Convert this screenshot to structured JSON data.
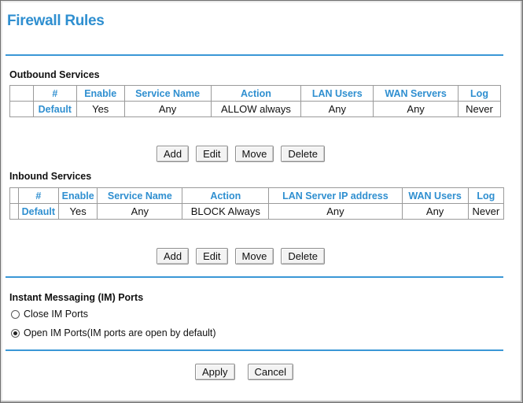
{
  "page": {
    "title": "Firewall Rules"
  },
  "outbound": {
    "heading": "Outbound Services",
    "columns": [
      "#",
      "Enable",
      "Service Name",
      "Action",
      "LAN Users",
      "WAN Servers",
      "Log"
    ],
    "rows": [
      [
        "Default",
        "Yes",
        "Any",
        "ALLOW always",
        "Any",
        "Any",
        "Never"
      ]
    ],
    "buttons": {
      "add": "Add",
      "edit": "Edit",
      "move": "Move",
      "delete": "Delete"
    }
  },
  "inbound": {
    "heading": "Inbound Services",
    "columns": [
      "#",
      "Enable",
      "Service Name",
      "Action",
      "LAN Server IP address",
      "WAN Users",
      "Log"
    ],
    "rows": [
      [
        "Default",
        "Yes",
        "Any",
        "BLOCK Always",
        "Any",
        "Any",
        "Never"
      ]
    ],
    "buttons": {
      "add": "Add",
      "edit": "Edit",
      "move": "Move",
      "delete": "Delete"
    }
  },
  "im": {
    "heading": "Instant Messaging (IM) Ports",
    "options": [
      {
        "label": "Close IM Ports",
        "selected": false
      },
      {
        "label": "Open IM Ports(IM ports are open by default)",
        "selected": true
      }
    ]
  },
  "footer": {
    "apply": "Apply",
    "cancel": "Cancel"
  },
  "colors": {
    "accent": "#2f8fd0",
    "rule": "#3a97d6"
  }
}
